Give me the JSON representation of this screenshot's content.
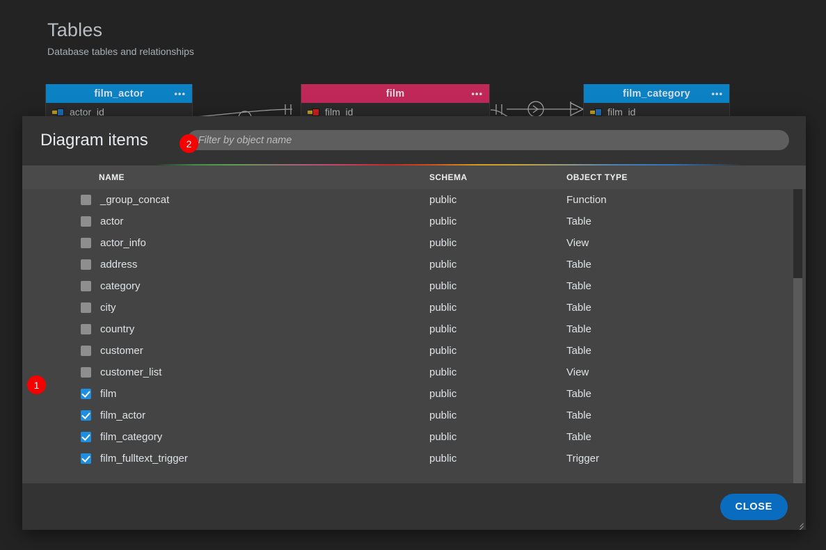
{
  "page": {
    "title": "Tables",
    "subtitle": "Database tables and relationships"
  },
  "diagram": {
    "nodes": [
      {
        "title": "film_actor",
        "accent": "#0c82c4",
        "menu": "•••",
        "first_column": "actor_id",
        "key": "blue"
      },
      {
        "title": "film",
        "accent": "#c0285a",
        "menu": "•••",
        "first_column": "film_id",
        "key": "red"
      },
      {
        "title": "film_category",
        "accent": "#0c82c4",
        "menu": "•••",
        "first_column": "film_id",
        "key": "blue"
      }
    ]
  },
  "dialog": {
    "title": "Diagram items",
    "filter": {
      "value": "",
      "placeholder": "Filter by object name"
    },
    "columns": {
      "name": "NAME",
      "schema": "SCHEMA",
      "object_type": "OBJECT TYPE"
    },
    "rows": [
      {
        "name": "_group_concat",
        "schema": "public",
        "type": "Function",
        "checked": false
      },
      {
        "name": "actor",
        "schema": "public",
        "type": "Table",
        "checked": false
      },
      {
        "name": "actor_info",
        "schema": "public",
        "type": "View",
        "checked": false
      },
      {
        "name": "address",
        "schema": "public",
        "type": "Table",
        "checked": false
      },
      {
        "name": "category",
        "schema": "public",
        "type": "Table",
        "checked": false
      },
      {
        "name": "city",
        "schema": "public",
        "type": "Table",
        "checked": false
      },
      {
        "name": "country",
        "schema": "public",
        "type": "Table",
        "checked": false
      },
      {
        "name": "customer",
        "schema": "public",
        "type": "Table",
        "checked": false
      },
      {
        "name": "customer_list",
        "schema": "public",
        "type": "View",
        "checked": false
      },
      {
        "name": "film",
        "schema": "public",
        "type": "Table",
        "checked": true
      },
      {
        "name": "film_actor",
        "schema": "public",
        "type": "Table",
        "checked": true
      },
      {
        "name": "film_category",
        "schema": "public",
        "type": "Table",
        "checked": true
      },
      {
        "name": "film_fulltext_trigger",
        "schema": "public",
        "type": "Trigger",
        "checked": true
      }
    ],
    "close_label": "CLOSE"
  },
  "annotations": [
    {
      "id": "1",
      "label": "1"
    },
    {
      "id": "2",
      "label": "2"
    }
  ],
  "colors": {
    "accent_blue": "#0c82c4",
    "accent_pink": "#c0285a",
    "checkbox_checked": "#1e8fe0",
    "button_primary": "#0a6cbf",
    "badge_red": "#f80000"
  }
}
